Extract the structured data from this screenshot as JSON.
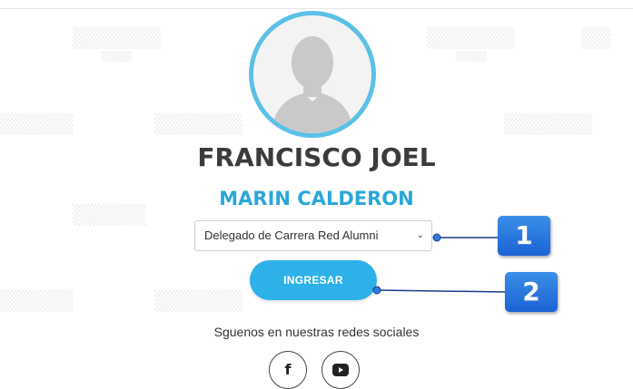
{
  "profile": {
    "first_name": "FRANCISCO JOEL",
    "last_name": "MARIN CALDERON"
  },
  "role_select": {
    "selected": "Delegado de Carrera Red Alumni"
  },
  "login_button": "INGRESAR",
  "social": {
    "follow_text": "Sguenos en nuestras redes sociales"
  },
  "annotations": {
    "badge_1": "1",
    "badge_2": "2"
  },
  "colors": {
    "accent": "#2eb0e8",
    "avatar_ring": "#5bc0e6",
    "name_dark": "#3b3b3b",
    "name_blue": "#2aa7d9",
    "badge_blue": "#1b63d6"
  }
}
